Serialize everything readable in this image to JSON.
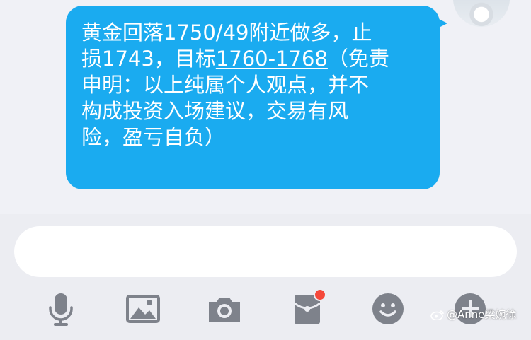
{
  "message": {
    "line1": "黄金回落1750/49附近做多，止",
    "line2_prefix": "损1743，目标",
    "line2_link": "1760-1768",
    "line2_suffix": "（免责",
    "line3": "申明：以上纯属个人观点，并不",
    "line4": "构成投资入场建议，交易有风",
    "line5": "险，盈亏自负）"
  },
  "input": {
    "value": "",
    "placeholder": ""
  },
  "toolbar": {
    "icons": [
      "microphone-icon",
      "image-icon",
      "camera-icon",
      "red-packet-icon",
      "emoji-icon",
      "plus-icon"
    ],
    "red_packet_badge": true
  },
  "watermark": {
    "text": "@Anne梁婉徐"
  },
  "colors": {
    "bubble": "#1aabf0",
    "icon": "#7e828b",
    "badge": "#f5483a",
    "input_bg": "#ffffff",
    "panel_bg": "#ecedf2"
  }
}
